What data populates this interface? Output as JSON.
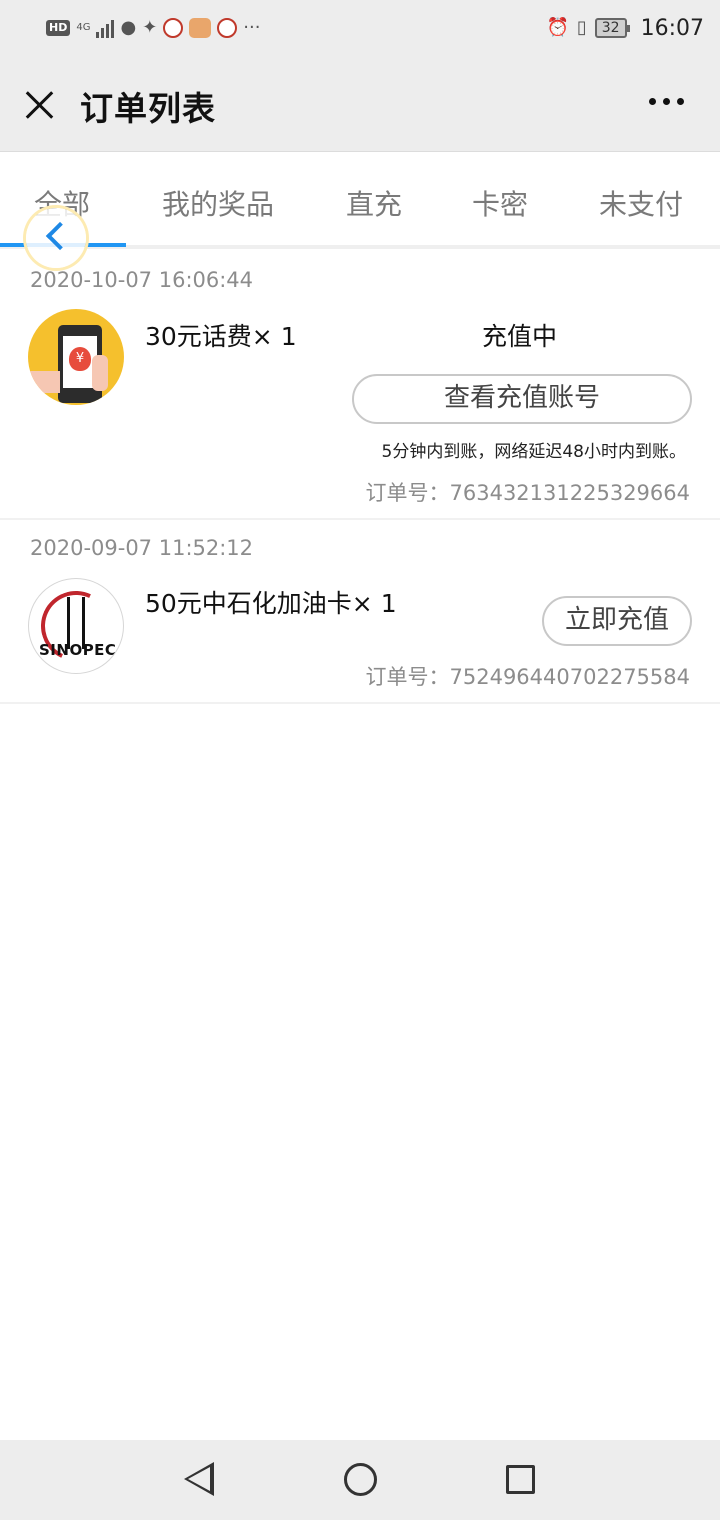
{
  "status_bar": {
    "hd": "HD",
    "network": "4G",
    "more": "···",
    "battery": "32",
    "time": "16:07",
    "icons": [
      "hd-icon",
      "signal-icon",
      "wechat-icon",
      "alipay-icon",
      "app-icon",
      "app-icon",
      "app-icon",
      "alarm-icon",
      "vibrate-icon",
      "battery-icon"
    ]
  },
  "header": {
    "title": "订单列表",
    "close_icon": "close-icon",
    "more_icon": "more-icon"
  },
  "tabs": [
    {
      "label": "全部",
      "active": true
    },
    {
      "label": "我的奖品",
      "active": false
    },
    {
      "label": "直充",
      "active": false
    },
    {
      "label": "卡密",
      "active": false
    },
    {
      "label": "未支付",
      "active": false
    }
  ],
  "accent_color": "#2196f3",
  "orders": [
    {
      "time": "2020-10-07 16:06:44",
      "name": "30元话费× 1",
      "status": "充值中",
      "action": "查看充值账号",
      "note": "5分钟内到账，网络延迟48小时内到账。",
      "order_no": "订单号：763432131225329664",
      "thumb_icon": "phone-recharge-icon",
      "thumb_symbol": "¥"
    },
    {
      "time": "2020-09-07 11:52:12",
      "name": "50元中石化加油卡× 1",
      "action": "立即充值",
      "order_no": "订单号：752496440702275584",
      "thumb_icon": "sinopec-logo",
      "thumb_brand": "SINOPEC"
    }
  ],
  "nav": {
    "icons": [
      "back-icon",
      "home-icon",
      "recents-icon"
    ]
  }
}
